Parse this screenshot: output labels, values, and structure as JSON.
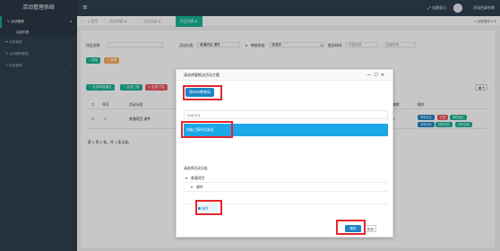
{
  "app": {
    "title": "活动管理系统"
  },
  "sidebar": {
    "items": [
      {
        "label": "活动管理",
        "icon": "wrench-icon",
        "active": true
      },
      {
        "label": "评审管理",
        "icon": "flag-icon"
      },
      {
        "label": "活动跟踪管理",
        "icon": "chat-icon"
      },
      {
        "label": "系统管理",
        "icon": "puzzle-icon"
      }
    ],
    "sub": "活动列表"
  },
  "topbar": {
    "fullscreen": "全屏显示",
    "user": "活动目录名称"
  },
  "tabs": {
    "home": "首页",
    "list": [
      {
        "label": "活动列表"
      },
      {
        "label": "活动分组"
      },
      {
        "label": "作品列表",
        "active": true
      }
    ],
    "right": "页签操作"
  },
  "form": {
    "name_label": "作品名称:",
    "category_label": "活动分类:",
    "category_value": "普通项目-课件",
    "status_label": "审核状态:",
    "status_value": "请选择",
    "time_label": "提交时间:",
    "start_ph": "开始时间",
    "end_ph": "结束时间",
    "search_btn": "搜索",
    "reset_btn": "重置"
  },
  "toolbar": {
    "b1": "全部审核通过",
    "b2": "全部上报",
    "b3": "全部下发"
  },
  "table": {
    "headers": [
      "序号",
      "活动分组",
      "活动分组",
      "删除",
      "操作"
    ],
    "row": {
      "no": "1",
      "group": "普通项目-课件",
      "count": "0"
    },
    "actions": [
      "评审意见",
      "打回",
      "审核通过",
      "评审活动",
      "评审作品",
      "评审记录"
    ]
  },
  "pager": "第 1 到 1 条，共 1 条记录。",
  "modal": {
    "title": "请选择要推送活动主题",
    "chip": "郑州市教育局",
    "search_value": "240711",
    "result": "市级三赛评比测试",
    "tree_title": "请选择活动分组",
    "tree": [
      {
        "label": "普通项目",
        "level": 0
      },
      {
        "label": "课件",
        "level": 1
      },
      {
        "label": "课件",
        "level": 2,
        "selected": true
      }
    ],
    "confirm": "确定",
    "close": "关闭"
  }
}
